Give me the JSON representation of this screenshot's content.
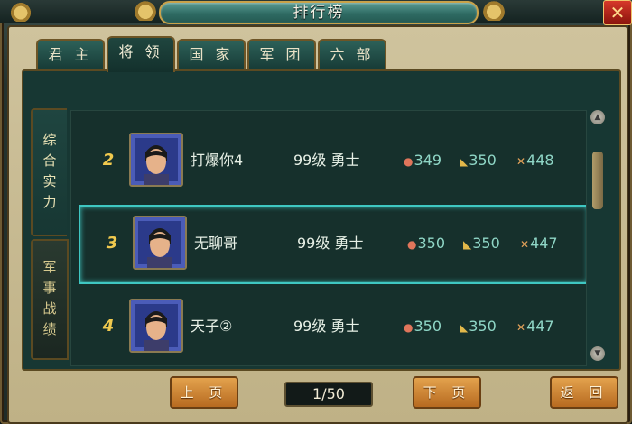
{
  "window": {
    "title": "排行榜"
  },
  "tabs": [
    {
      "label": "君 主",
      "active": false
    },
    {
      "label": "将 领",
      "active": true
    },
    {
      "label": "国 家",
      "active": false
    },
    {
      "label": "军 团",
      "active": false
    },
    {
      "label": "六 部",
      "active": false
    }
  ],
  "side_tabs": [
    {
      "chars": [
        "综",
        "合",
        "实",
        "力"
      ],
      "active": true
    },
    {
      "chars": [
        "军",
        "事",
        "战",
        "绩"
      ],
      "active": false
    }
  ],
  "rows": [
    {
      "rank": "2",
      "name": "打爆你4",
      "level": "99级 勇士",
      "stat1": "349",
      "stat2": "350",
      "stat3": "448",
      "selected": false
    },
    {
      "rank": "3",
      "name": "无聊哥",
      "level": "99级 勇士",
      "stat1": "350",
      "stat2": "350",
      "stat3": "447",
      "selected": true
    },
    {
      "rank": "4",
      "name": "天子②",
      "level": "99级 勇士",
      "stat1": "350",
      "stat2": "350",
      "stat3": "447",
      "selected": false
    }
  ],
  "icons": {
    "stat1": "fist-icon",
    "stat2": "boot-icon",
    "stat3": "sword-icon"
  },
  "footer": {
    "prev_label": "上 页",
    "page_indicator": "1/50",
    "next_label": "下 页",
    "back_label": "返 回"
  },
  "colors": {
    "accent": "#3fc7c2",
    "rank": "#f0c94e",
    "button": "#d08a36",
    "stat_text": "#8fd6c6"
  }
}
